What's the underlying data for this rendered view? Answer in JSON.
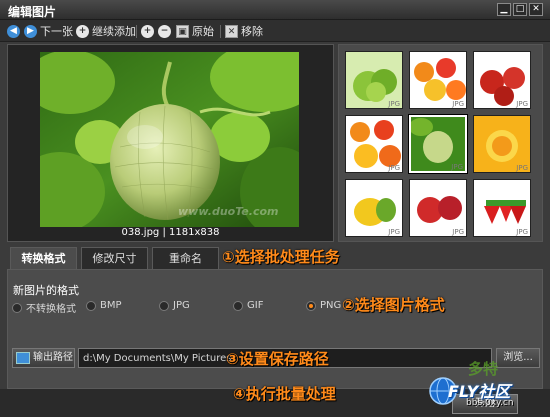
{
  "window": {
    "title": "编辑图片"
  },
  "toolbar": {
    "next_label": "下一张",
    "add_label": "继续添加",
    "original_label": "原始",
    "remove_label": "移除"
  },
  "preview": {
    "caption": "038.jpg | 1181x838",
    "watermark": "www.duoTe.com"
  },
  "thumbnails": [
    {
      "tag": "JPG",
      "selected": false
    },
    {
      "tag": "JPG",
      "selected": false
    },
    {
      "tag": "JPG",
      "selected": false
    },
    {
      "tag": "JPG",
      "selected": false
    },
    {
      "tag": "JPG",
      "selected": true
    },
    {
      "tag": "JPG",
      "selected": false
    },
    {
      "tag": "JPG",
      "selected": false
    },
    {
      "tag": "JPG",
      "selected": false
    },
    {
      "tag": "JPG",
      "selected": false
    }
  ],
  "tabs": [
    {
      "label": "转换格式",
      "active": true
    },
    {
      "label": "修改尺寸",
      "active": false
    },
    {
      "label": "重命名",
      "active": false
    }
  ],
  "format": {
    "section_label": "新图片的格式",
    "options": [
      "不转换格式",
      "BMP",
      "JPG",
      "GIF",
      "PNG"
    ],
    "selected": "PNG"
  },
  "output": {
    "button_label": "输出路径",
    "path_value": "d:\\My Documents\\My Pictures",
    "browse_label": "浏览..."
  },
  "start_button": {
    "label": "开始"
  },
  "annotations": {
    "step1": "①选择批处理任务",
    "step2": "②选择图片格式",
    "step3": "③设置保存路径",
    "step4": "④执行批量处理"
  },
  "logo": {
    "fly": "FLY社区",
    "url": "bbs.0xy.cn",
    "watermark": "多特"
  },
  "colors": {
    "accent": "#ff8a1a",
    "panel": "#4c4c4c",
    "titlebar": "#2e2e2e"
  }
}
